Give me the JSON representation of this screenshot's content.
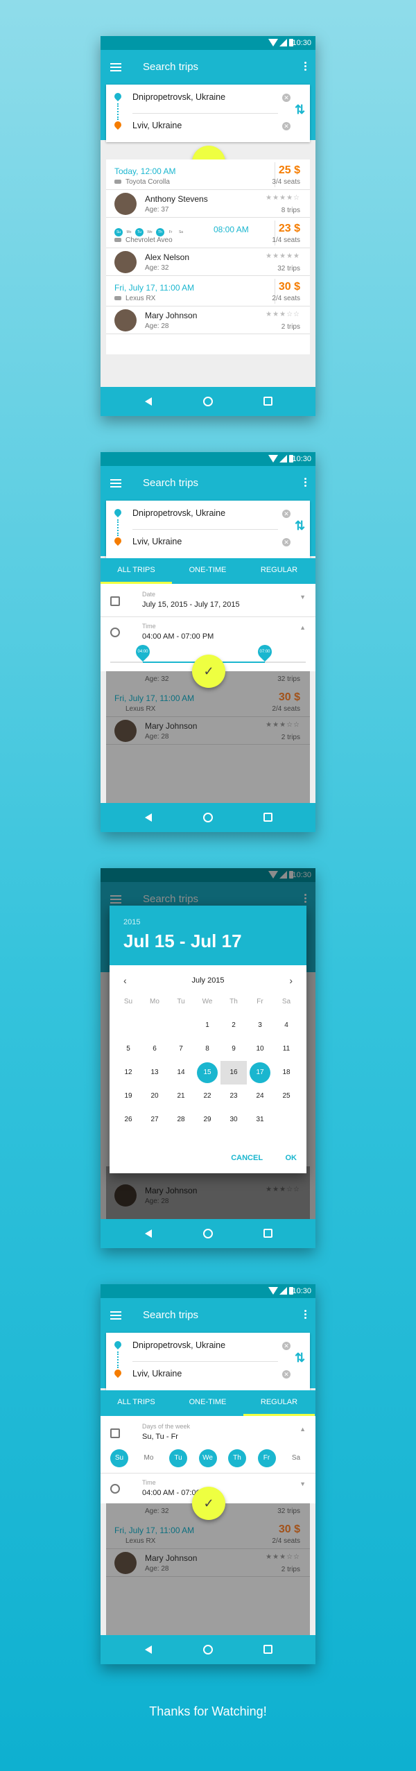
{
  "status_time": "10:30",
  "app_title": "Search trips",
  "from_location": "Dnipropetrovsk, Ukraine",
  "to_location": "Lviv, Ukraine",
  "clear_glyph": "✕",
  "swap_glyph": "⇅",
  "fab_filter_glyph": "≡",
  "fab_done_glyph": "✓",
  "trips": [
    {
      "date": "Today, 12:00 AM",
      "car": "Toyota Corolla",
      "price": "25 $",
      "seats": "3/4 seats",
      "driver": {
        "name": "Anthony Stevens",
        "age": "Age: 37",
        "rating": "★★★★☆",
        "trips": "8 trips"
      }
    },
    {
      "days": [
        "Su",
        "Mo",
        "Tu",
        "We",
        "Th",
        "Fr",
        "Sa"
      ],
      "days_on": [
        true,
        false,
        true,
        false,
        true,
        false,
        false
      ],
      "time": "08:00 AM",
      "car": "Chevrolet Aveo",
      "price": "23 $",
      "seats": "1/4 seats",
      "driver": {
        "name": "Alex Nelson",
        "age": "Age: 32",
        "rating": "★★★★★",
        "trips": "32 trips"
      }
    },
    {
      "date": "Fri, July 17, 11:00 AM",
      "car": "Lexus RX",
      "price": "30 $",
      "seats": "2/4 seats",
      "driver": {
        "name": "Mary Johnson",
        "age": "Age: 28",
        "rating": "★★★☆☆",
        "trips": "2 trips"
      }
    }
  ],
  "tabs": [
    "All trips",
    "One-time",
    "Regular"
  ],
  "filter": {
    "date_label": "Date",
    "date_value": "July 15, 2015 - July 17, 2015",
    "time_label": "Time",
    "time_value": "04:00 AM - 07:00 PM",
    "slider_from": "04:00",
    "slider_to": "07:00",
    "slider_start_fraction": 0.167,
    "slider_end_fraction": 0.792,
    "days_label": "Days of the week",
    "days_value": "Su, Tu - Fr",
    "weekdays": [
      "Su",
      "Mo",
      "Tu",
      "We",
      "Th",
      "Fr",
      "Sa"
    ],
    "weekdays_on": [
      true,
      false,
      true,
      true,
      true,
      true,
      false
    ]
  },
  "behind_rows": {
    "age": "Age: 32",
    "trips": "32 trips"
  },
  "datepicker": {
    "year": "2015",
    "range": "Jul 15 - Jul 17",
    "month": "July 2015",
    "prev": "‹",
    "next": "›",
    "weekdays": [
      "Su",
      "Mo",
      "Tu",
      "We",
      "Th",
      "Fr",
      "Sa"
    ],
    "first_weekday_index": 3,
    "days_in_month": 31,
    "selected_from": 15,
    "selected_to": 17,
    "cancel": "CANCEL",
    "ok": "OK"
  },
  "footer": "Thanks for Watching!"
}
